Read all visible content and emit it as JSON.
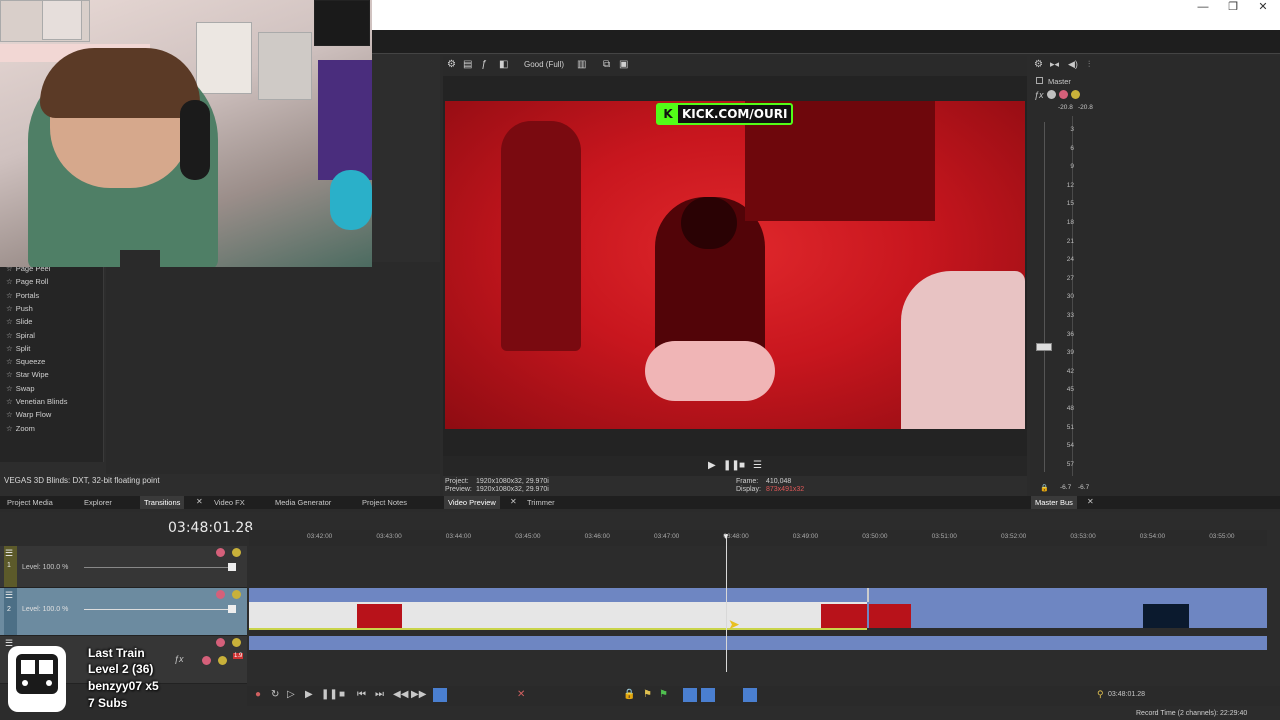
{
  "window": {
    "minimize": "—",
    "restore": "❐",
    "close": "✕"
  },
  "transitions": {
    "items": [
      "Page Peel",
      "Page Roll",
      "Portals",
      "Push",
      "Slide",
      "Spiral",
      "Split",
      "Squeeze",
      "Star Wipe",
      "Swap",
      "Venetian Blinds",
      "Warp Flow",
      "Zoom"
    ],
    "status": "VEGAS 3D Blinds: DXT, 32-bit floating point"
  },
  "preview": {
    "quality": "Good (Full)",
    "kick_text": "KICK.COM/OURI",
    "kick_letter": "K",
    "project_label": "Project:",
    "project_value": "1920x1080x32, 29.970i",
    "preview_label": "Preview:",
    "preview_value": "1920x1080x32, 29.970i",
    "frame_label": "Frame:",
    "frame_value": "410,048",
    "display_label": "Display:",
    "display_value": "873x491x32"
  },
  "master": {
    "title": "Master",
    "peak_left": "-20.8",
    "peak_right": "-20.8",
    "scale": [
      "3",
      "6",
      "9",
      "12",
      "15",
      "18",
      "21",
      "24",
      "27",
      "30",
      "33",
      "36",
      "39",
      "42",
      "45",
      "48",
      "51",
      "54",
      "57"
    ],
    "bottom_left": "-6.7",
    "bottom_right": "-6.7"
  },
  "tabs": {
    "project_media": "Project Media",
    "explorer": "Explorer",
    "transitions": "Transitions",
    "video_fx": "Video FX",
    "media_generator": "Media Generator",
    "project_notes": "Project Notes",
    "video_preview": "Video Preview",
    "trimmer": "Trimmer",
    "master_bus": "Master Bus"
  },
  "timeline": {
    "timecode": "03:48:01.28",
    "ruler": [
      "03:42:00",
      "03:43:00",
      "03:44:00",
      "03:45:00",
      "03:46:00",
      "03:47:00",
      "03:48:00",
      "03:49:00",
      "03:50:00",
      "03:51:00",
      "03:52:00",
      "03:53:00",
      "03:54:00",
      "03:55:00"
    ],
    "track1_level": "Level: 100.0 %",
    "track2_level": "Level: 100.0 %",
    "track_num_1": "1",
    "track_num_2": "2",
    "audio_db": "1.9",
    "cursor_time": "03:48:01.28",
    "record_time": "Record Time (2 channels): 22:29:40"
  },
  "overlay": {
    "line1": "Last Train",
    "line2": "Level 2  (36)",
    "line3": "benzyy07 x5",
    "line4": "7 Subs"
  },
  "colors": {
    "video_red": "#d01a22",
    "kick_green": "#53fc18",
    "track_blue": "#6e86c2",
    "track_header_yellow": "#5c5a2a"
  }
}
